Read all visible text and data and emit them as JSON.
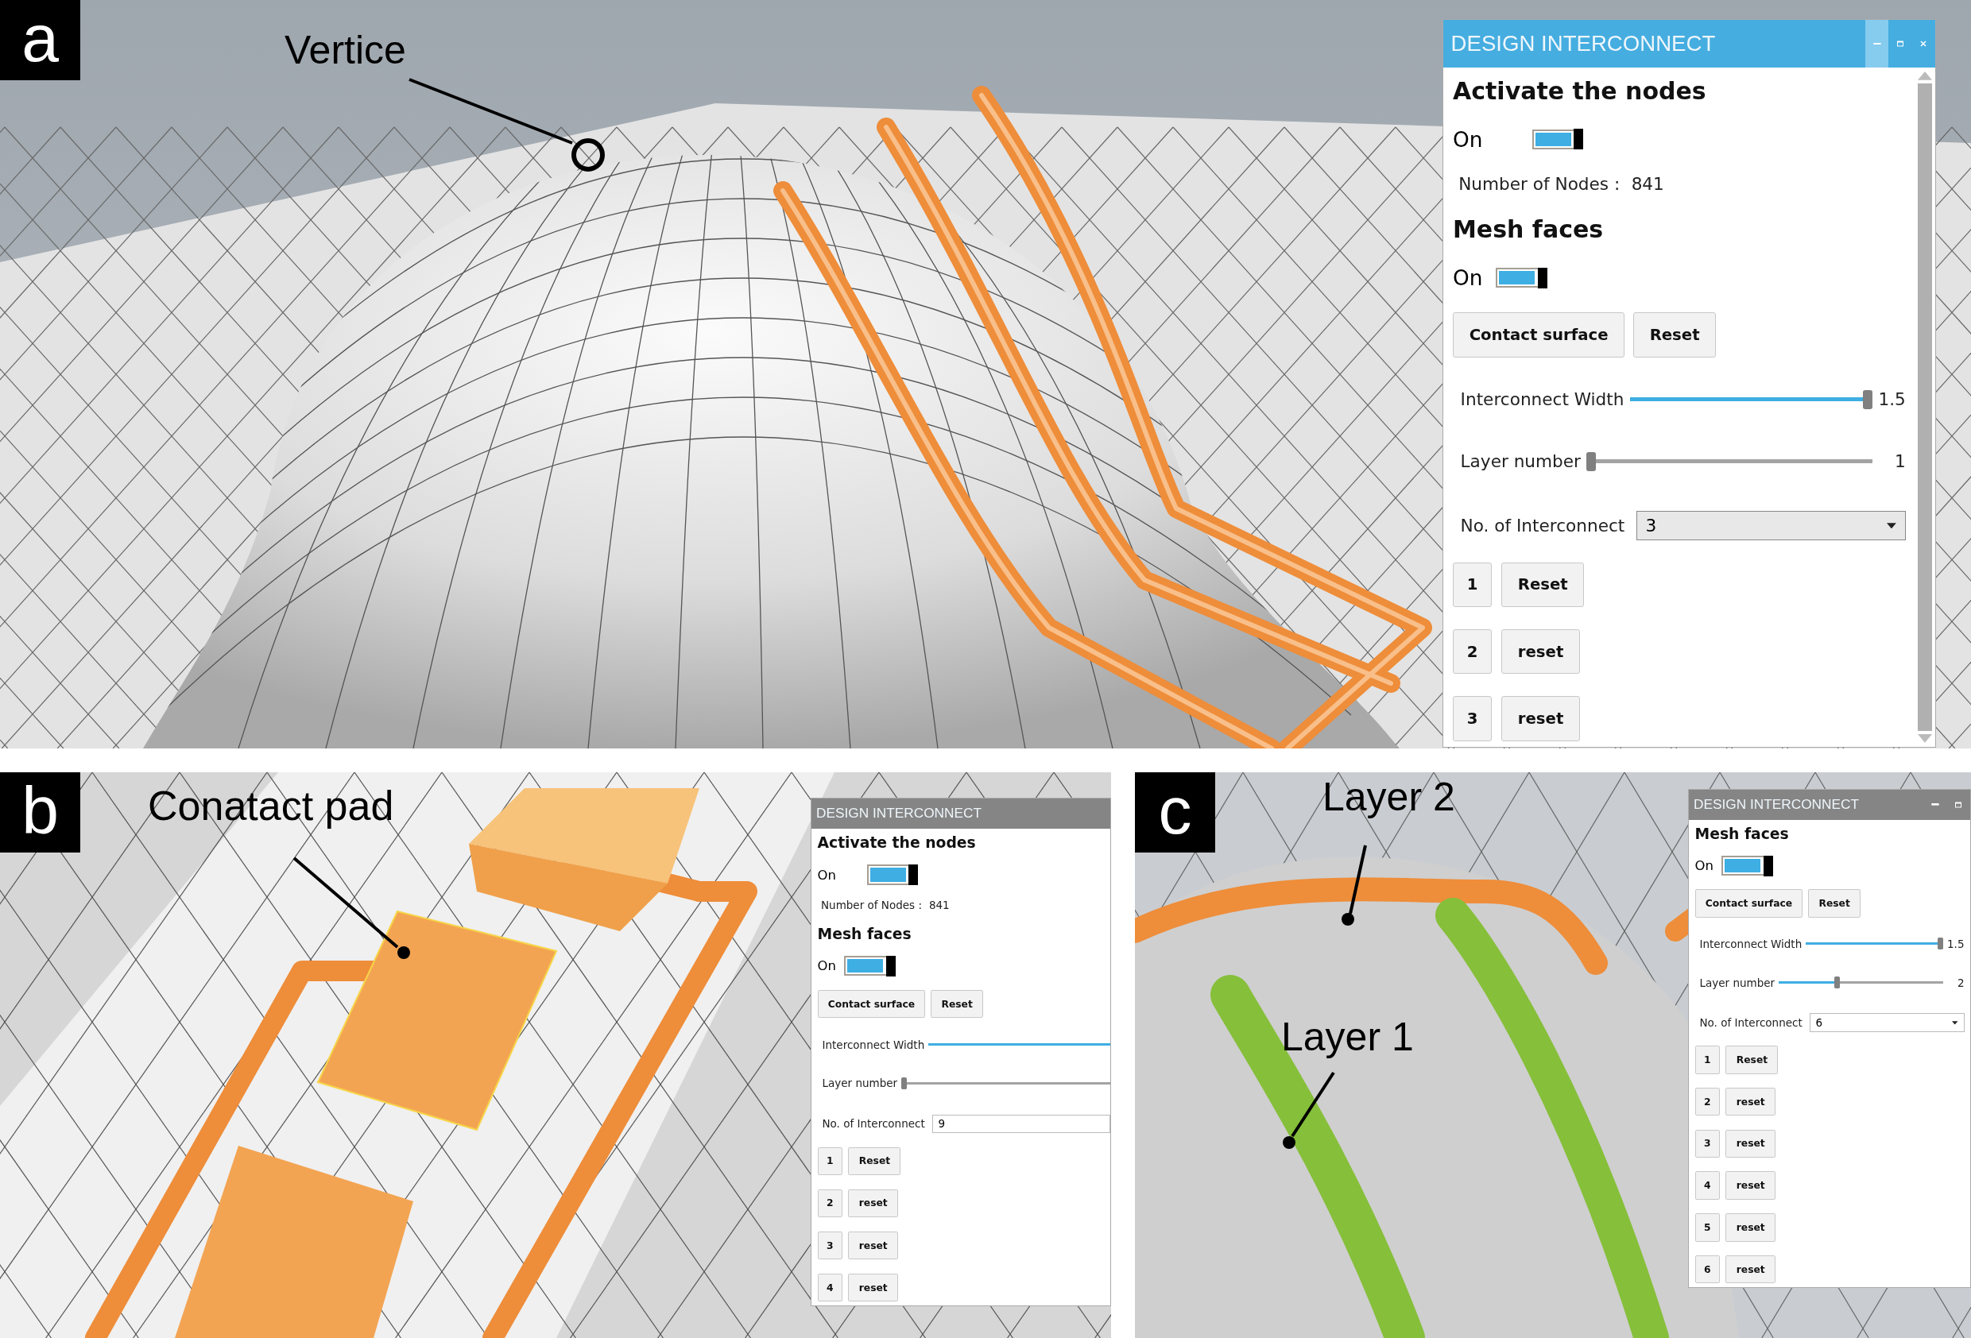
{
  "panels": [
    {
      "letter": "a",
      "annotations": [
        {
          "text": "Vertice",
          "kind": "ring"
        }
      ],
      "window": {
        "title": "DESIGN INTERCONNECT",
        "controls": [
          {
            "kind": "minimize",
            "hovered": true
          },
          {
            "kind": "maximize",
            "hovered": false
          },
          {
            "kind": "close",
            "hovered": false
          }
        ],
        "scrollbar": true,
        "items": [
          {
            "kind": "heading",
            "text": "Activate the nodes"
          },
          {
            "kind": "toggle",
            "label": "On",
            "on": true,
            "wide": true
          },
          {
            "kind": "info",
            "label": "Number of Nodes :",
            "value": "841"
          },
          {
            "kind": "heading",
            "text": "Mesh faces"
          },
          {
            "kind": "toggle",
            "label": "On",
            "on": true,
            "wide": false
          },
          {
            "kind": "buttons",
            "labels": [
              "Contact surface",
              "Reset"
            ]
          },
          {
            "kind": "slider",
            "label": "Interconnect Width",
            "level": 1,
            "reading": "1.5"
          },
          {
            "kind": "slider",
            "label": "Layer number",
            "level": 0,
            "reading": "1"
          },
          {
            "kind": "dropdown",
            "label": "No. of Interconnect",
            "value": "3",
            "arrow": true
          },
          {
            "kind": "rows",
            "rows": [
              {
                "number": "1",
                "action": "Reset"
              },
              {
                "number": "2",
                "action": "reset"
              },
              {
                "number": "3",
                "action": "reset"
              }
            ]
          }
        ]
      }
    },
    {
      "letter": "b",
      "annotations": [
        {
          "text": "Conatact pad",
          "kind": "dot"
        }
      ],
      "window": {
        "title": "DESIGN INTERCONNECT",
        "items": [
          {
            "kind": "heading",
            "text": "Activate the nodes"
          },
          {
            "kind": "toggle",
            "label": "On",
            "on": true,
            "wide": true
          },
          {
            "kind": "info",
            "label": "Number of Nodes :",
            "value": "841"
          },
          {
            "kind": "heading",
            "text": "Mesh faces"
          },
          {
            "kind": "toggle",
            "label": "On",
            "on": true,
            "wide": false
          },
          {
            "kind": "buttons",
            "labels": [
              "Contact surface",
              "Reset"
            ]
          },
          {
            "kind": "slider",
            "label": "Interconnect Width",
            "level": 1
          },
          {
            "kind": "slider",
            "label": "Layer number",
            "level": 0
          },
          {
            "kind": "dropdown",
            "label": "No. of Interconnect",
            "value": "9",
            "arrow": false
          },
          {
            "kind": "rows",
            "rows": [
              {
                "number": "1",
                "action": "Reset"
              },
              {
                "number": "2",
                "action": "reset"
              },
              {
                "number": "3",
                "action": "reset"
              },
              {
                "number": "4",
                "action": "reset"
              }
            ]
          }
        ]
      }
    },
    {
      "letter": "c",
      "annotations": [
        {
          "text": "Layer 2",
          "kind": "dot"
        },
        {
          "text": "Layer 1",
          "kind": "dot"
        }
      ],
      "window": {
        "title": "DESIGN INTERCONNECT",
        "controls": [
          {
            "kind": "minimize",
            "hovered": false
          },
          {
            "kind": "maximize",
            "hovered": false
          }
        ],
        "items": [
          {
            "kind": "heading",
            "text": "Mesh faces"
          },
          {
            "kind": "toggle",
            "label": "On",
            "on": true,
            "wide": false
          },
          {
            "kind": "buttons",
            "labels": [
              "Contact surface",
              "Reset"
            ]
          },
          {
            "kind": "slider",
            "label": "Interconnect Width",
            "level": 1,
            "reading": "1.5"
          },
          {
            "kind": "slider",
            "label": "Layer number",
            "level": 0.35,
            "reading": "2"
          },
          {
            "kind": "dropdown",
            "label": "No. of Interconnect",
            "value": "6",
            "arrow": true
          },
          {
            "kind": "rows",
            "rows": [
              {
                "number": "1",
                "action": "Reset"
              },
              {
                "number": "2",
                "action": "reset"
              },
              {
                "number": "3",
                "action": "reset"
              },
              {
                "number": "4",
                "action": "reset"
              },
              {
                "number": "5",
                "action": "reset"
              },
              {
                "number": "6",
                "action": "reset"
              }
            ]
          }
        ]
      }
    }
  ]
}
